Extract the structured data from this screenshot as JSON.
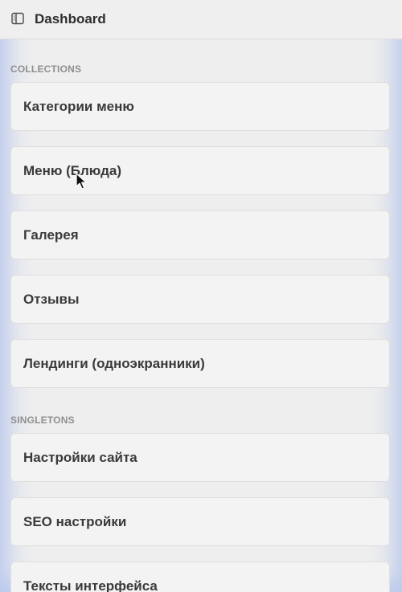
{
  "header": {
    "icon": "sidebar-toggle-icon",
    "title": "Dashboard"
  },
  "sections": {
    "collections": {
      "label": "COLLECTIONS",
      "items": [
        {
          "label": "Категории меню"
        },
        {
          "label": "Меню (Блюда)"
        },
        {
          "label": "Галерея"
        },
        {
          "label": "Отзывы"
        },
        {
          "label": "Лендинги (одноэкранники)"
        }
      ]
    },
    "singletons": {
      "label": "SINGLETONS",
      "items": [
        {
          "label": "Настройки сайта"
        },
        {
          "label": "SEO настройки"
        },
        {
          "label": "Тексты интерфейса"
        }
      ]
    }
  },
  "colors": {
    "background": "#eeeeee",
    "card": "#f3f3f3",
    "text": "#3a3a3a",
    "section_label": "#8f8f8f",
    "window_glow": "#a5b9eb"
  }
}
